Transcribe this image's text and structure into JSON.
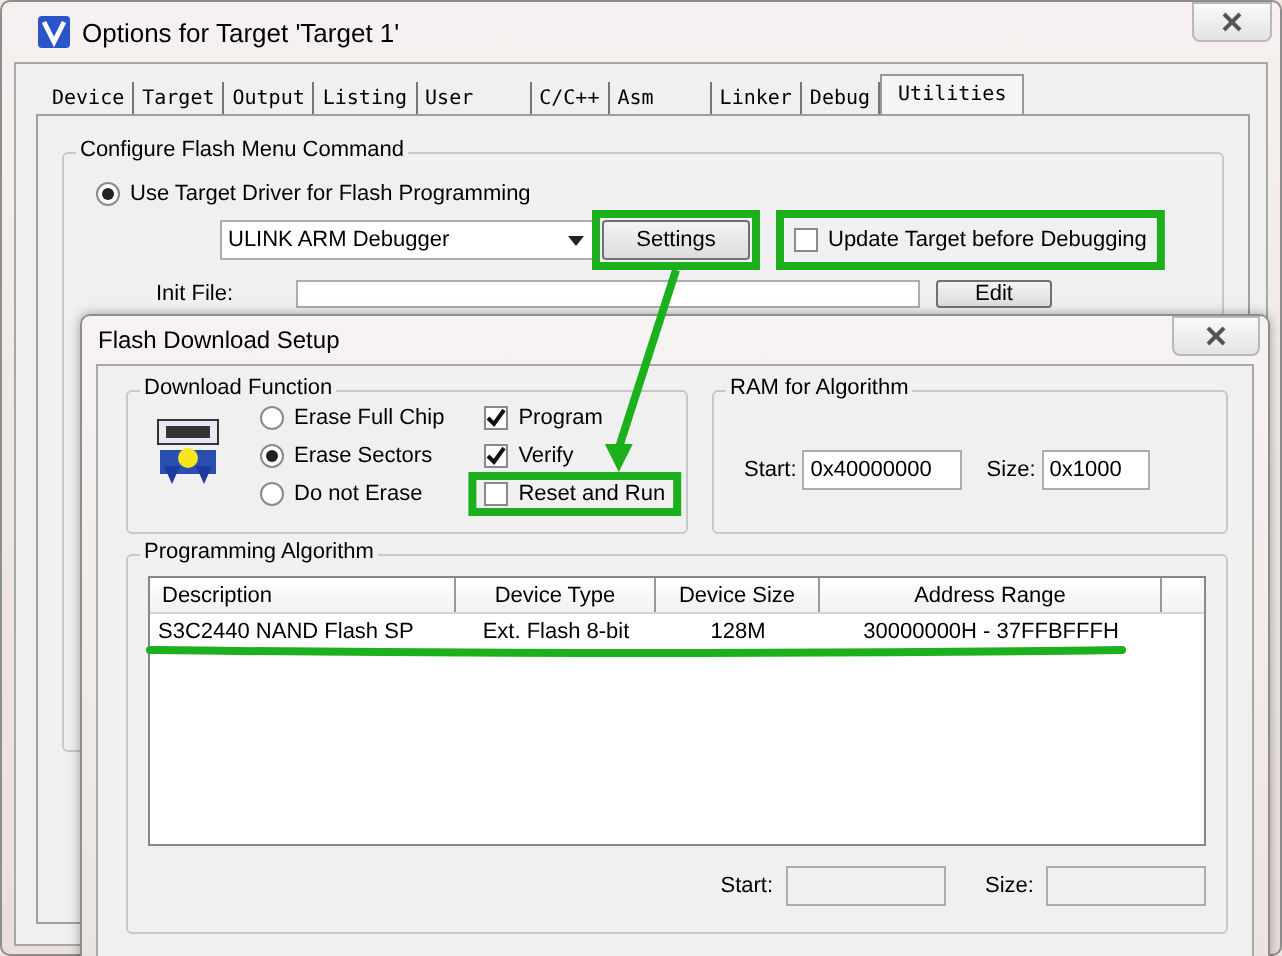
{
  "main_window": {
    "title": "Options for Target 'Target 1'",
    "tabs": [
      {
        "label": "Device",
        "selected": false
      },
      {
        "label": "Target",
        "selected": false
      },
      {
        "label": "Output",
        "selected": false
      },
      {
        "label": "Listing",
        "selected": false
      },
      {
        "label": "User",
        "selected": false
      },
      {
        "label": "C/C++",
        "selected": false
      },
      {
        "label": "Asm",
        "selected": false
      },
      {
        "label": "Linker",
        "selected": false
      },
      {
        "label": "Debug",
        "selected": false
      },
      {
        "label": "Utilities",
        "selected": true
      }
    ],
    "flash_menu": {
      "title": "Configure Flash Menu Command",
      "use_target_driver": {
        "label": "Use Target Driver for Flash Programming",
        "selected": true
      },
      "driver": "ULINK ARM Debugger",
      "settings_button": "Settings",
      "update_target": {
        "label": "Update Target before Debugging",
        "checked": false
      },
      "init_file_label": "Init File:",
      "edit_button": "Edit"
    }
  },
  "flash_dialog": {
    "title": "Flash Download Setup",
    "download_function": {
      "title": "Download Function",
      "erase_options": [
        {
          "label": "Erase Full Chip",
          "selected": false
        },
        {
          "label": "Erase Sectors",
          "selected": true
        },
        {
          "label": "Do not Erase",
          "selected": false
        }
      ],
      "actions": [
        {
          "label": "Program",
          "checked": true
        },
        {
          "label": "Verify",
          "checked": true
        },
        {
          "label": "Reset and Run",
          "checked": false
        }
      ]
    },
    "ram": {
      "title": "RAM for Algorithm",
      "start_label": "Start:",
      "start": "0x40000000",
      "size_label": "Size:",
      "size": "0x1000"
    },
    "algorithm": {
      "title": "Programming Algorithm",
      "columns": [
        "Description",
        "Device Type",
        "Device Size",
        "Address Range"
      ],
      "rows": [
        [
          "S3C2440 NAND Flash SP",
          "Ext. Flash 8-bit",
          "128M",
          "30000000H - 37FFBFFFH"
        ]
      ],
      "start_label": "Start:",
      "size_label": "Size:"
    }
  }
}
